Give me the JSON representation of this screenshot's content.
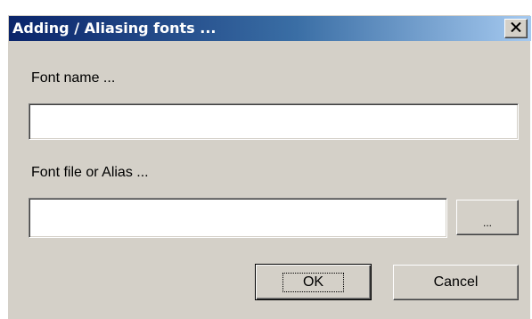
{
  "window": {
    "title": "Adding / Aliasing fonts ...",
    "close_symbol": "close-icon"
  },
  "form": {
    "font_name_label": "Font name ...",
    "font_name_value": "",
    "font_file_label": "Font file or Alias ...",
    "font_file_value": "",
    "browse_label": "..."
  },
  "buttons": {
    "ok_label": "OK",
    "cancel_label": "Cancel"
  },
  "colors": {
    "title_gradient_start": "#0a246a",
    "title_gradient_end": "#a6caf0",
    "dialog_face": "#d4d0c8"
  }
}
